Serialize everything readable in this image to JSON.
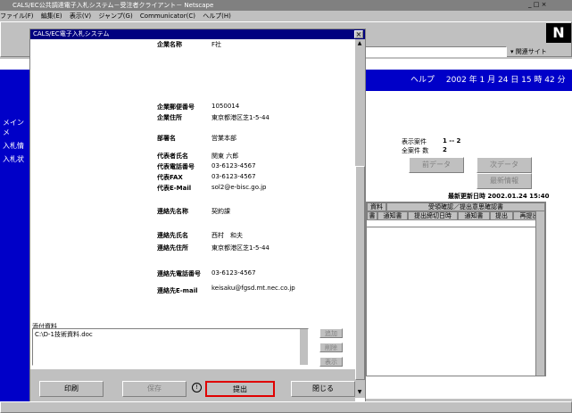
{
  "browser": {
    "title": "CALS/EC公共調達電子入札システム－受注者クライアント－ Netscape",
    "menu": [
      "ファイル(F)",
      "編集(E)",
      "表示(V)",
      "ジャンプ(G)",
      "Communicator(C)",
      "ヘルプ(H)"
    ],
    "logo": "N",
    "related_sites": "関連サイト"
  },
  "left_nav": [
    "メインメ",
    "入札情",
    "入札状"
  ],
  "banner": {
    "help": "ヘルプ",
    "date": "2002 年 1 月 24 日 15 時 42 分"
  },
  "right_panel": {
    "display_items_label": "表示案件",
    "display_items_value": "1 -- 2",
    "total_items_label": "全案件 数",
    "total_items_value": "2",
    "prev_button": "前データ",
    "next_button": "次データ",
    "refresh_button": "最新情報",
    "last_updated": "最新更新日時 2002.01.24 15:40",
    "table_headers": {
      "group1": "資料",
      "group2": "受領確認／提出意思確認書",
      "cols": [
        "書",
        "通知書",
        "提出締切日時",
        "通知書",
        "提出",
        "再提出"
      ]
    }
  },
  "popup": {
    "title": "CALS/EC電子入札システム",
    "fields": [
      {
        "label": "企業名称",
        "value": "F社"
      },
      {
        "label": "企業郵便番号",
        "value": "1050014"
      },
      {
        "label": "企業住所",
        "value": "東京都港区芝1-5-44"
      },
      {
        "label": "部署名",
        "value": "営業本部"
      },
      {
        "label": "代表者氏名",
        "value": "関東 六郎"
      },
      {
        "label": "代表電話番号",
        "value": "03-6123-4567"
      },
      {
        "label": "代表FAX",
        "value": "03-6123-4567"
      },
      {
        "label": "代表E-Mail",
        "value": "sol2@e-bisc.go.jp"
      },
      {
        "label": "連絡先名称",
        "value": "契約課"
      },
      {
        "label": "連絡先氏名",
        "value": "西村　和夫"
      },
      {
        "label": "連絡先住所",
        "value": "東京都港区芝1-5-44"
      },
      {
        "label": "連絡先電話番号",
        "value": "03-6123-4567"
      },
      {
        "label": "連絡先E-mail",
        "value": "keisaku@fgsd.mt.nec.co.jp"
      }
    ],
    "attach_label": "添付資料",
    "attach_file": "C:\\D-1技術資料.doc",
    "side_buttons": [
      "追加",
      "削除",
      "表示"
    ],
    "buttons": {
      "print": "印刷",
      "save": "保存",
      "submit": "提出",
      "close": "閉じる"
    }
  },
  "colors": {
    "title_bar": "#000080",
    "nav_blue": "#0000c8",
    "highlight": "#e00000"
  }
}
